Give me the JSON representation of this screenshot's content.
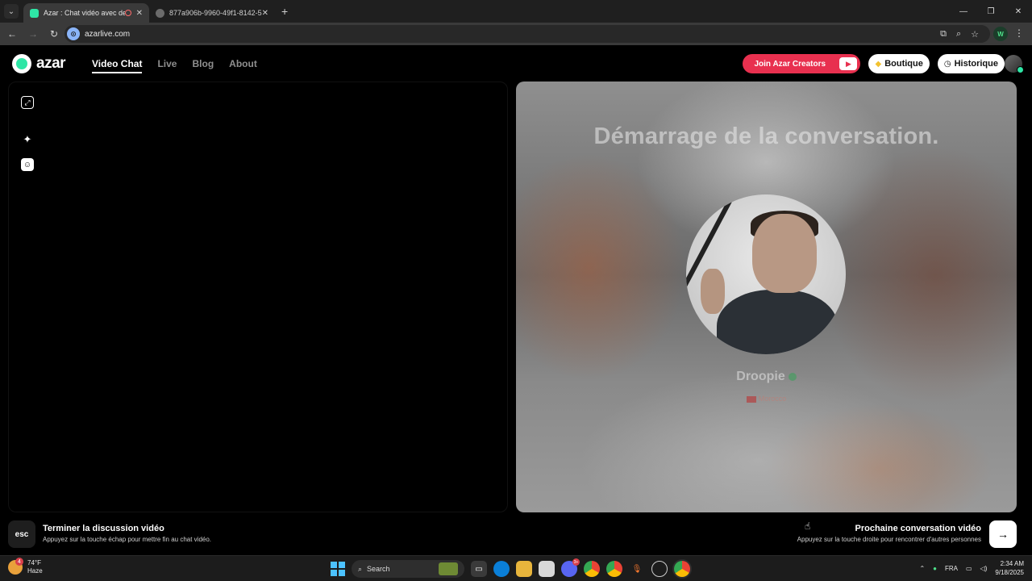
{
  "browser": {
    "tabs": [
      {
        "title": "Azar : Chat vidéo avec de n",
        "active": true
      },
      {
        "title": "877a906b-9960-49f1-8142-5bd",
        "active": false
      }
    ],
    "url": "azarlive.com",
    "profile_initial": "W"
  },
  "site": {
    "logo_text": "azar",
    "nav": [
      {
        "label": "Video Chat",
        "active": true
      },
      {
        "label": "Live",
        "active": false
      },
      {
        "label": "Blog",
        "active": false
      },
      {
        "label": "About",
        "active": false
      }
    ],
    "join_creators_label": "Join Azar Creators",
    "boutique_label": "Boutique",
    "historique_label": "Historique"
  },
  "peer": {
    "status_title": "Démarrage de la conversation.",
    "name": "Droopie",
    "country": "Morocco"
  },
  "controls": {
    "esc_key": "esc",
    "end_title": "Terminer la discussion vidéo",
    "end_subtitle": "Appuyez sur la touche échap pour mettre fin au chat vidéo.",
    "next_title": "Prochaine conversation vidéo",
    "next_subtitle": "Appuyez sur la touche droite pour rencontrer d'autres personnes"
  },
  "taskbar": {
    "weather_temp": "74°F",
    "weather_desc": "Haze",
    "weather_badge": "4",
    "search_label": "Search",
    "discord_badge": "3+",
    "language": "FRA",
    "time": "2:34 AM",
    "date": "9/18/2025"
  },
  "colors": {
    "brand_green": "#2ee6a6",
    "creators_red": "#e8304f"
  }
}
